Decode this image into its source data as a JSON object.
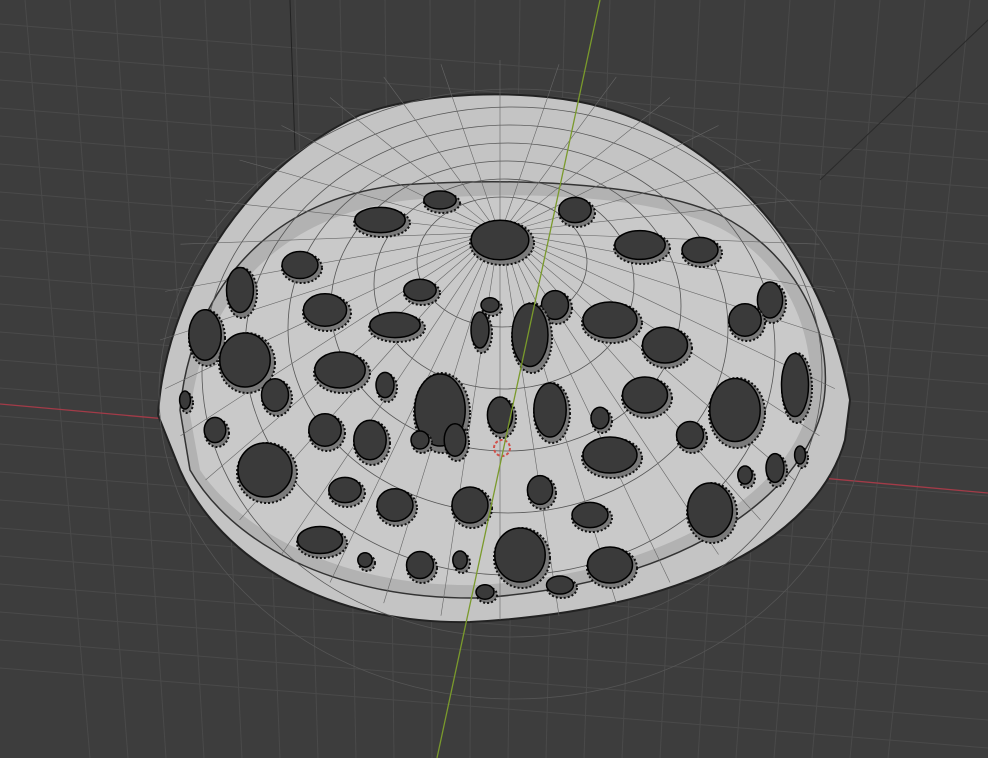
{
  "viewport": {
    "background_color": "#3d3d3d",
    "grid_color": "#4a4a4a",
    "x_axis_color": "#a33b48",
    "y_axis_color": "#7a9a2c",
    "mesh_color": "#c8c8c8",
    "mesh_inner_color": "#b4b4b4",
    "vertex_color": "#000000"
  }
}
